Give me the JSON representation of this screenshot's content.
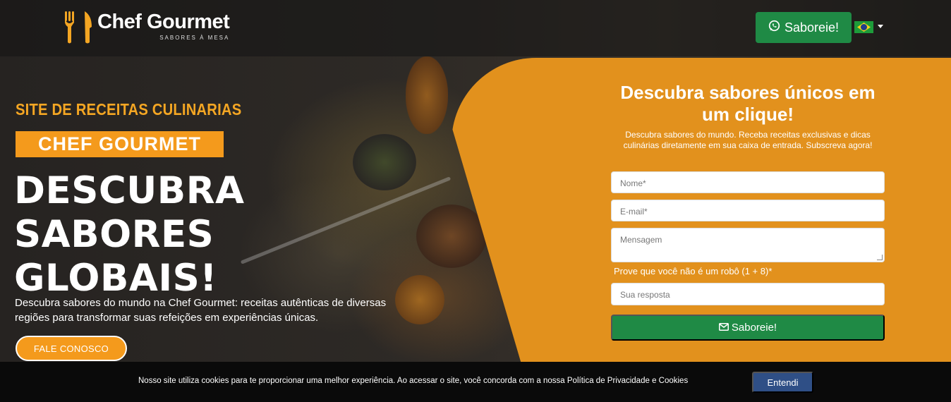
{
  "header": {
    "logo_name": "Chef Gourmet",
    "logo_tagline": "SABORES À MESA",
    "whatsapp_label": "Saboreie!",
    "language_flag": "brazil-flag-icon"
  },
  "hero": {
    "subtitle": "SITE DE RECEITAS CULINARIAS",
    "badge": "CHEF GOURMET",
    "headline_line1": "DESCUBRA",
    "headline_line2": "SABORES",
    "headline_line3": "GLOBAIS!",
    "description": "Descubra sabores do mundo na Chef Gourmet: receitas autênticas de diversas regiões para transformar suas refeições em experiências únicas.",
    "cta_label": "FALE CONOSCO"
  },
  "form": {
    "title": "Descubra sabores únicos em um clique!",
    "description": "Descubra sabores do mundo. Receba receitas exclusivas e dicas culinárias diretamente em sua caixa de entrada. Subscreva agora!",
    "name_placeholder": "Nome*",
    "email_placeholder": "E-mail*",
    "message_placeholder": "Mensagem",
    "captcha_label": "Prove que você não é um robô (1 + 8)*",
    "answer_placeholder": "Sua resposta",
    "submit_label": "Saboreie!"
  },
  "cookie": {
    "text": "Nosso site utiliza cookies para te proporcionar uma melhor experiência. Ao acessar o site, você concorda com a nossa Política de Privacidade e Cookies",
    "button": "Entendi"
  },
  "colors": {
    "accent_orange": "#f49a1c",
    "panel_orange": "#e2911d",
    "whatsapp_green": "#1f8a45",
    "cookie_button": "#2f4f86"
  }
}
